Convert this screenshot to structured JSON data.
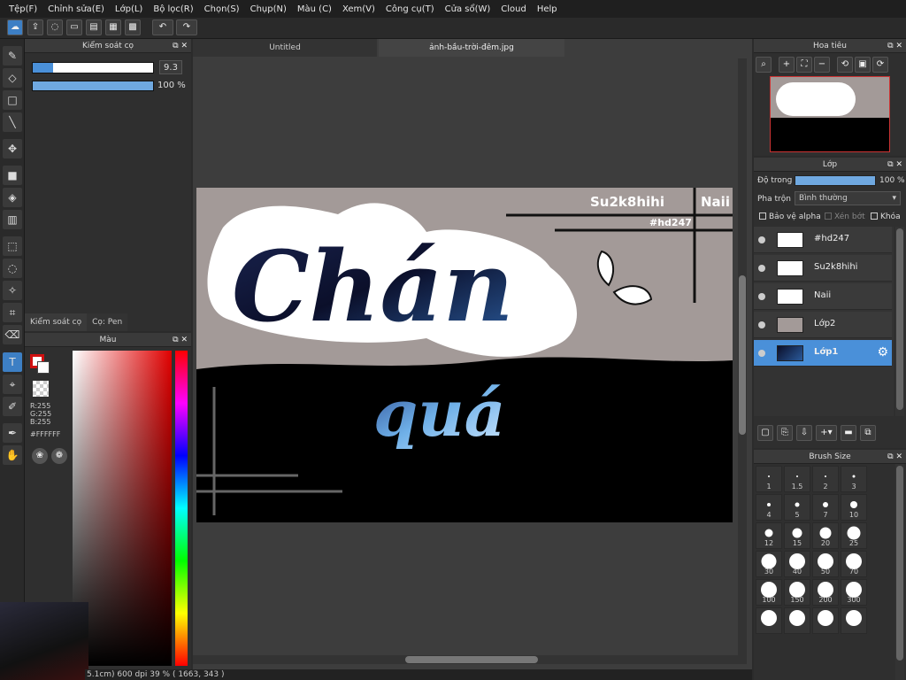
{
  "menu": [
    "Tệp(F)",
    "Chỉnh sửa(E)",
    "Lớp(L)",
    "Bộ lọc(R)",
    "Chọn(S)",
    "Chụp(N)",
    "Màu (C)",
    "Xem(V)",
    "Công cụ(T)",
    "Cửa sổ(W)",
    "Cloud",
    "Help"
  ],
  "brush_control": {
    "title": "Kiểm soát cọ",
    "size_value": "9.3",
    "size_fraction": 0.17,
    "opacity_value": "100 %",
    "opacity_fraction": 1.0,
    "tabs": [
      "Kiểm soát cọ",
      "Cọ: Pen"
    ]
  },
  "color_panel": {
    "title": "Màu",
    "r": "R:255",
    "g": "G:255",
    "b": "B:255",
    "hex": "#FFFFFF"
  },
  "document_tabs": [
    "Untitled",
    "ảnh-bầu-trời-đêm.jpg"
  ],
  "artwork": {
    "main_text": "Chán",
    "sub_text": "quá",
    "tag1": "Su2k8hihi",
    "tag2": "Naii",
    "tag3": "#hd247"
  },
  "status_bar": "5.1cm)  600 dpi  39 %  ( 1663, 343 )",
  "navigator": {
    "title": "Hoa tiêu"
  },
  "layer_panel": {
    "title": "Lớp",
    "opacity_label": "Độ trong",
    "opacity_value": "100 %",
    "blend_label": "Pha trộn",
    "blend_value": "Bình thường",
    "protect_alpha": "Bảo vệ alpha",
    "clipping": "Xén bớt",
    "lock": "Khóa",
    "layers": [
      "#hd247",
      "Su2k8hihi",
      "Naii",
      "Lớp2",
      "Lớp1"
    ],
    "selected_index": 4
  },
  "brush_size_panel": {
    "title": "Brush Size",
    "sizes": [
      "1",
      "1.5",
      "2",
      "3",
      "4",
      "5",
      "7",
      "10",
      "12",
      "15",
      "20",
      "25",
      "30",
      "40",
      "50",
      "70",
      "100",
      "150",
      "200",
      "300"
    ]
  },
  "colors": {
    "accent": "#4a90d9",
    "canvas_bg": "#3d3d3d"
  }
}
